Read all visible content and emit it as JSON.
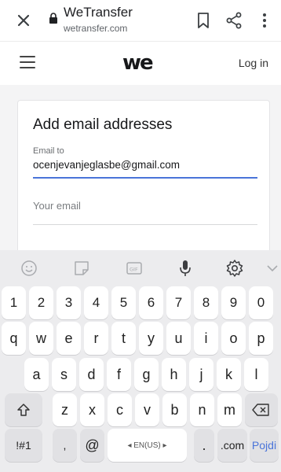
{
  "browser": {
    "title": "WeTransfer",
    "url": "wetransfer.com",
    "icons": [
      "close-icon",
      "lock-icon",
      "bookmark-icon",
      "share-icon",
      "more-vert-icon"
    ]
  },
  "header": {
    "logo": "we",
    "login_label": "Log in"
  },
  "form": {
    "title": "Add email addresses",
    "email_to_label": "Email to",
    "email_to_value": "ocenjevanjeglasbe@gmail.com",
    "your_email_placeholder": "Your email"
  },
  "keyboard": {
    "toolbar_icons": [
      "emoji-icon",
      "sticker-icon",
      "gif-icon",
      "microphone-icon",
      "settings-icon",
      "chevron-down-icon"
    ],
    "row_numbers": [
      "1",
      "2",
      "3",
      "4",
      "5",
      "6",
      "7",
      "8",
      "9",
      "0"
    ],
    "row1": [
      "q",
      "w",
      "e",
      "r",
      "t",
      "y",
      "u",
      "i",
      "o",
      "p"
    ],
    "row2": [
      "a",
      "s",
      "d",
      "f",
      "g",
      "h",
      "j",
      "k",
      "l"
    ],
    "row3": [
      "z",
      "x",
      "c",
      "v",
      "b",
      "n",
      "m"
    ],
    "symbols_label": "!#1",
    "comma_label": ",",
    "at_label": "@",
    "space_label": "◂ EN(US) ▸",
    "period_label": ".",
    "dotcom_label": ".com",
    "go_label": "Pojdi",
    "accent_color": "#4a74d9"
  }
}
